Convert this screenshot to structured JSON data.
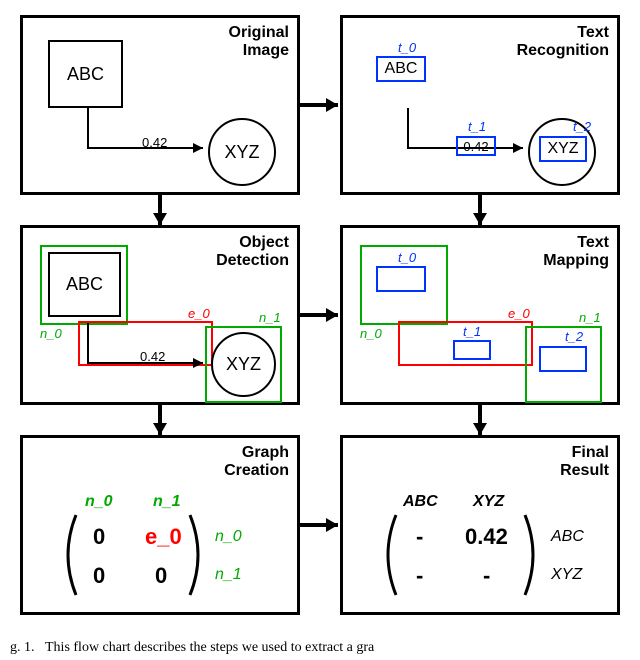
{
  "panels": {
    "original": {
      "title1": "Original",
      "title2": "Image"
    },
    "textrec": {
      "title1": "Text",
      "title2": "Recognition"
    },
    "objdet": {
      "title1": "Object",
      "title2": "Detection"
    },
    "textmap": {
      "title1": "Text",
      "title2": "Mapping"
    },
    "graph": {
      "title1": "Graph",
      "title2": "Creation"
    },
    "final": {
      "title1": "Final",
      "title2": "Result"
    }
  },
  "tokens": {
    "ABC": "ABC",
    "XYZ": "XYZ",
    "edge_weight": "0.42",
    "t0": "t_0",
    "t1": "t_1",
    "t2": "t_2",
    "n0": "n_0",
    "n1": "n_1",
    "e0": "e_0"
  },
  "matrix": {
    "row_labels": [
      "n_0",
      "n_1"
    ],
    "col_labels": [
      "n_0",
      "n_1"
    ],
    "cells": [
      [
        "0",
        "e_0"
      ],
      [
        "0",
        "0"
      ]
    ]
  },
  "result_matrix": {
    "row_labels": [
      "ABC",
      "XYZ"
    ],
    "col_labels": [
      "ABC",
      "XYZ"
    ],
    "cells": [
      [
        "-",
        "0.42"
      ],
      [
        "-",
        "-"
      ]
    ]
  },
  "caption_prefix": "g. 1.",
  "caption": "This flow chart describes the steps we used to extract a gra"
}
